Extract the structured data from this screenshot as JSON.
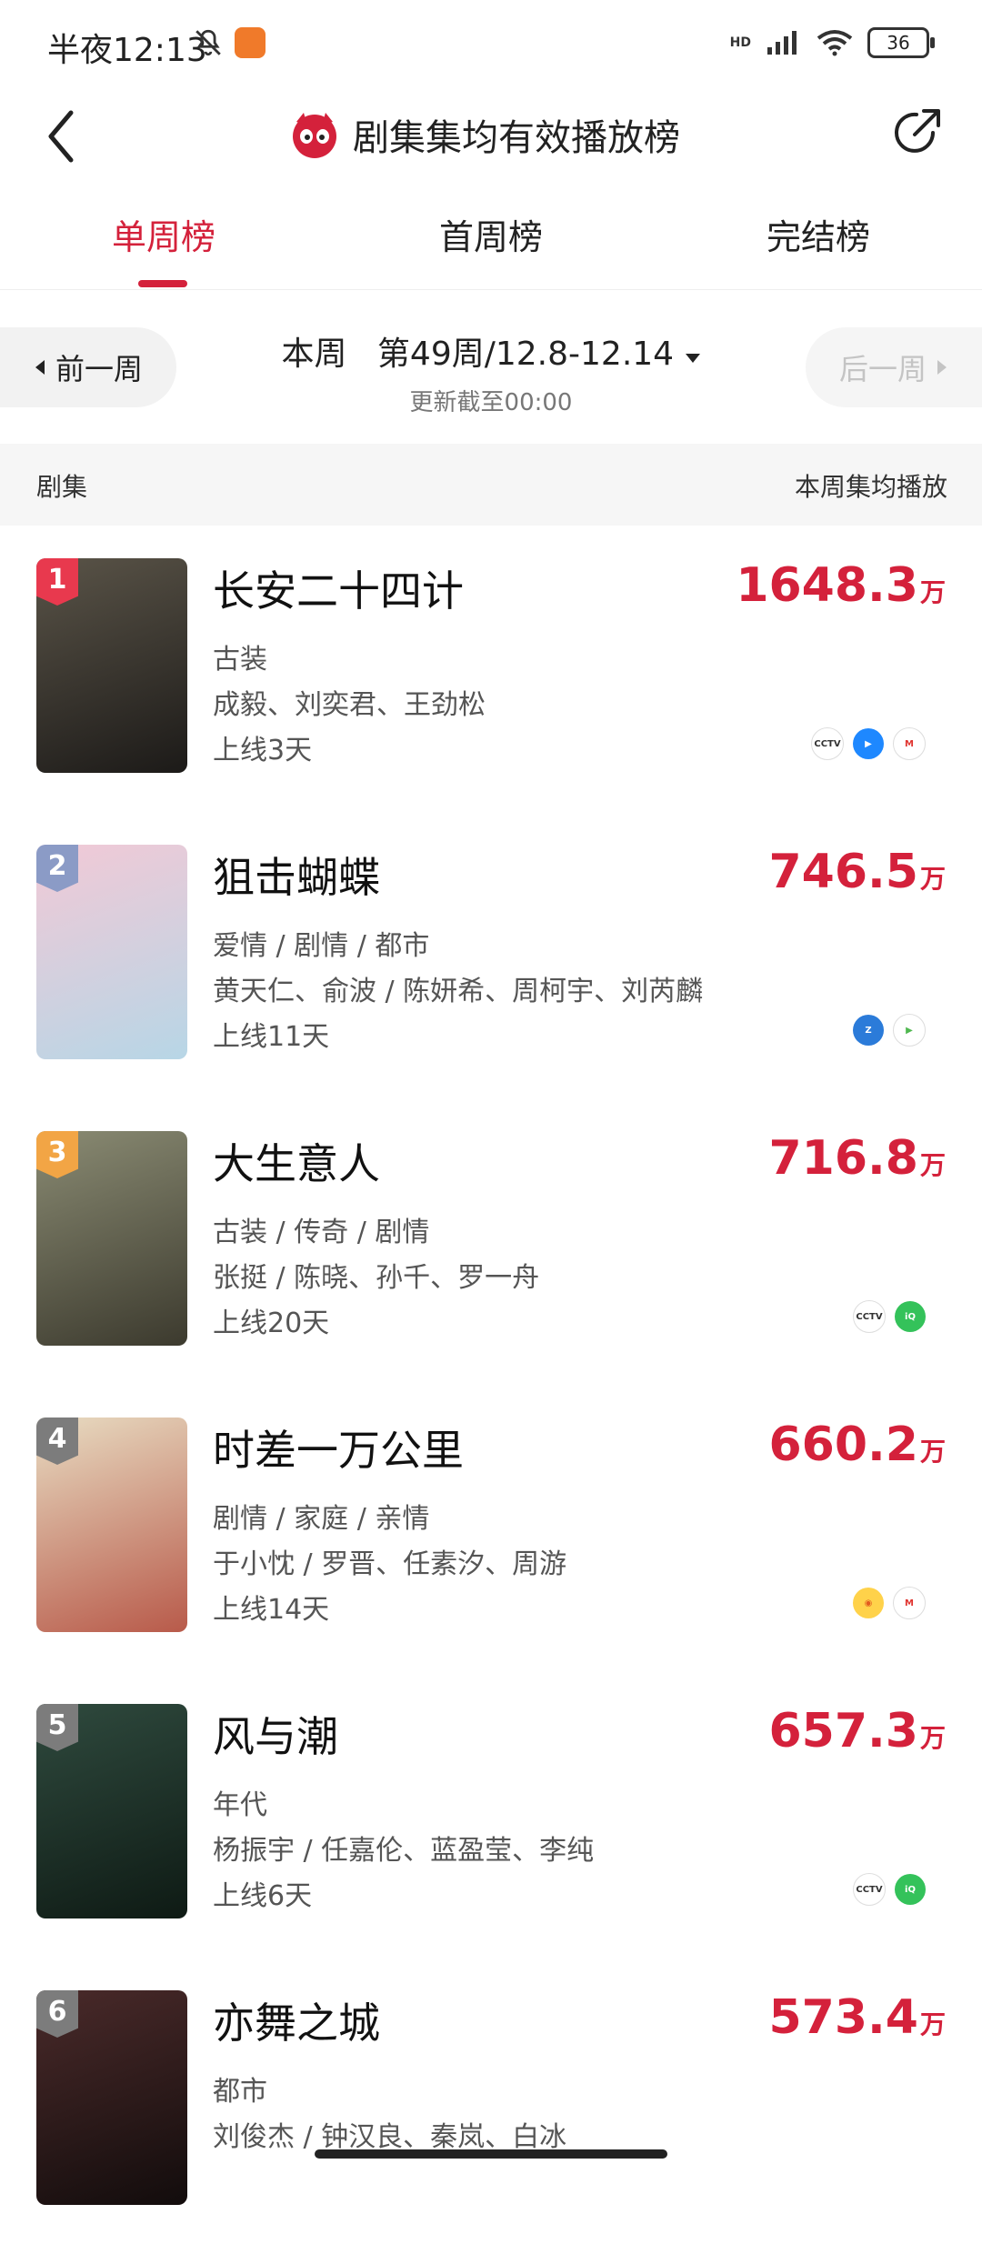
{
  "status_bar": {
    "time": "半夜12:13",
    "network": "HD",
    "battery": "36"
  },
  "header": {
    "title": "剧集集均有效播放榜"
  },
  "tabs": [
    {
      "label": "单周榜",
      "active": true
    },
    {
      "label": "首周榜",
      "active": false
    },
    {
      "label": "完结榜",
      "active": false
    }
  ],
  "week": {
    "prev": "前一周",
    "next": "后一周",
    "current_label": "本周",
    "range": "第49周/12.8-12.14",
    "update_note": "更新截至00:00"
  },
  "list_header": {
    "left": "剧集",
    "right": "本周集均播放"
  },
  "shows": [
    {
      "rank": "1",
      "name": "长安二十四计",
      "value": "1648.3",
      "unit": "万",
      "genre": "古装",
      "cast": "成毅、刘奕君、王劲松",
      "days": "上线3天",
      "rank_color": "#e8394e",
      "platform_icons": [
        "cctv-icon",
        "youku-icon",
        "mgtv-icon"
      ]
    },
    {
      "rank": "2",
      "name": "狙击蝴蝶",
      "value": "746.5",
      "unit": "万",
      "genre": "爱情 / 剧情 / 都市",
      "cast": "黄天仁、俞波 / 陈妍希、周柯宇、刘芮麟",
      "days": "上线11天",
      "rank_color": "#8b9bc6",
      "platform_icons": [
        "zhejiang-tv-icon",
        "tencent-video-icon"
      ]
    },
    {
      "rank": "3",
      "name": "大生意人",
      "value": "716.8",
      "unit": "万",
      "genre": "古装 / 传奇 / 剧情",
      "cast": "张挺 / 陈晓、孙千、罗一舟",
      "days": "上线20天",
      "rank_color": "#f2a545",
      "platform_icons": [
        "cctv-icon",
        "iqiyi-icon"
      ]
    },
    {
      "rank": "4",
      "name": "时差一万公里",
      "value": "660.2",
      "unit": "万",
      "genre": "剧情 / 家庭 / 亲情",
      "cast": "于小忱 / 罗晋、任素汐、周游",
      "days": "上线14天",
      "rank_color": "#7c7c7c",
      "platform_icons": [
        "hunan-tv-icon",
        "mgtv-icon"
      ]
    },
    {
      "rank": "5",
      "name": "风与潮",
      "value": "657.3",
      "unit": "万",
      "genre": "年代",
      "cast": "杨振宇 / 任嘉伦、蓝盈莹、李纯",
      "days": "上线6天",
      "rank_color": "#7c7c7c",
      "platform_icons": [
        "cctv-icon",
        "iqiyi-icon"
      ]
    },
    {
      "rank": "6",
      "name": "亦舞之城",
      "value": "573.4",
      "unit": "万",
      "genre": "都市",
      "cast": "刘俊杰 / 钟汉良、秦岚、白冰",
      "days": "",
      "rank_color": "#7c7c7c",
      "platform_icons": []
    }
  ],
  "colors": {
    "accent": "#d4213b"
  }
}
